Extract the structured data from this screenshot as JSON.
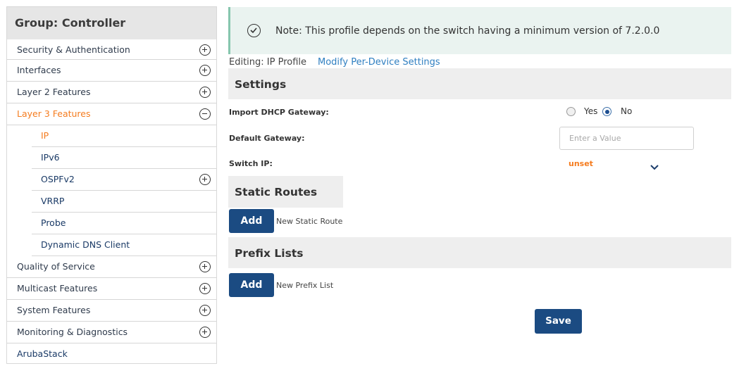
{
  "sidebar": {
    "title": "Group: Controller",
    "items": [
      {
        "label": "Security & Authentication",
        "expander": "plus"
      },
      {
        "label": "Interfaces",
        "expander": "plus"
      },
      {
        "label": "Layer 2 Features",
        "expander": "plus"
      },
      {
        "label": "Layer 3 Features",
        "expander": "minus",
        "active": true
      },
      {
        "label": "IP",
        "sub": true,
        "active": true
      },
      {
        "label": "IPv6",
        "sub": true
      },
      {
        "label": "OSPFv2",
        "sub": true,
        "expander": "plus"
      },
      {
        "label": "VRRP",
        "sub": true
      },
      {
        "label": "Probe",
        "sub": true
      },
      {
        "label": "Dynamic DNS Client",
        "sub": true
      },
      {
        "label": "Quality of Service",
        "expander": "plus"
      },
      {
        "label": "Multicast Features",
        "expander": "plus"
      },
      {
        "label": "System Features",
        "expander": "plus"
      },
      {
        "label": "Monitoring & Diagnostics",
        "expander": "plus"
      },
      {
        "label": "ArubaStack"
      }
    ]
  },
  "note": {
    "icon": "check-circle-icon",
    "text": "Note: This profile depends on the switch having a minimum version of 7.2.0.0"
  },
  "editing": {
    "label": "Editing: IP Profile",
    "link": "Modify Per-Device Settings"
  },
  "settings": {
    "title": "Settings",
    "import_dhcp_label": "Import DHCP Gateway:",
    "yes_label": "Yes",
    "no_label": "No",
    "import_dhcp_value": "No",
    "default_gateway_label": "Default Gateway:",
    "default_gateway_placeholder": "Enter a Value",
    "switch_ip_label": "Switch IP:",
    "switch_ip_value": "unset"
  },
  "static_routes": {
    "title": "Static Routes",
    "add_label": "Add",
    "caption": "New Static Route"
  },
  "prefix_lists": {
    "title": "Prefix Lists",
    "add_label": "Add",
    "caption": "New Prefix List"
  },
  "save_label": "Save",
  "colors": {
    "accent_orange": "#f57c1f",
    "button_navy": "#1b4b82",
    "link_blue": "#2f7fc1",
    "note_bg": "#eaf3f0"
  }
}
